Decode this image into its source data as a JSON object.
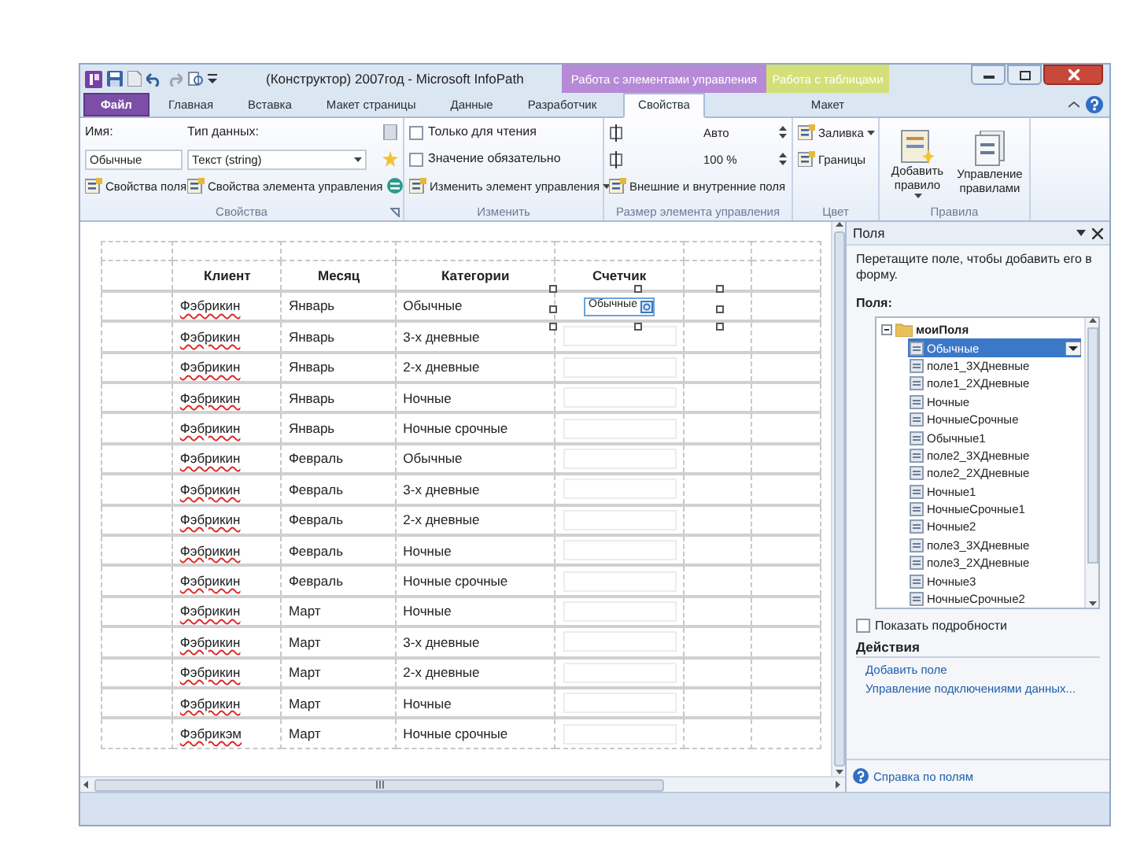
{
  "title_bar": {
    "title": "(Конструктор) 2007год - Microsoft InfoPath"
  },
  "tabs": [
    {
      "label": "Файл",
      "kind": "file",
      "selected": false
    },
    {
      "label": "Главная",
      "kind": "plain",
      "selected": false
    },
    {
      "label": "Вставка",
      "kind": "plain",
      "selected": false
    },
    {
      "label": "Макет страницы",
      "kind": "plain",
      "selected": false
    },
    {
      "label": "Данные",
      "kind": "plain",
      "selected": false
    },
    {
      "label": "Разработчик",
      "kind": "plain",
      "selected": false
    }
  ],
  "tool_groups": [
    {
      "label": "Работа с элементами управления",
      "color": "#b68ad6",
      "tabs": [
        {
          "label": "Свойства",
          "selected": true
        }
      ]
    },
    {
      "label": "Работа с таблицами",
      "color": "#d3df78",
      "tabs": [
        {
          "label": "Макет",
          "selected": false
        }
      ]
    }
  ],
  "ribbon": [
    {
      "label": "Свойства",
      "launcher": true,
      "rows": [
        [
          {
            "kind": "label",
            "text": "Имя:"
          },
          {
            "kind": "label",
            "text": "Тип данных:"
          },
          {
            "kind": "icon_button"
          }
        ],
        [
          {
            "kind": "field",
            "text": "Обычные"
          },
          {
            "kind": "field",
            "text": "Текст (string)",
            "dropdown": true
          },
          {
            "kind": "icon_button"
          }
        ],
        [
          {
            "kind": "button",
            "text": "Свойства поля"
          },
          {
            "kind": "button",
            "text": "Свойства элемента управления"
          },
          {
            "kind": "icon_button"
          }
        ]
      ]
    },
    {
      "label": "Изменить",
      "rows": [
        [
          {
            "kind": "checkbox",
            "text": "Только для чтения",
            "checked": false
          }
        ],
        [
          {
            "kind": "checkbox",
            "text": "Значение обязательно",
            "checked": false
          }
        ],
        [
          {
            "kind": "button",
            "text": "Изменить элемент управления",
            "dropdown": true
          }
        ]
      ]
    },
    {
      "label": "Размер элемента управления",
      "rows": [
        [
          {
            "kind": "spin",
            "text": "Авто"
          }
        ],
        [
          {
            "kind": "spin",
            "text": "100 %"
          }
        ],
        [
          {
            "kind": "button",
            "text": "Внешние и внутренние поля"
          }
        ]
      ]
    },
    {
      "label": "Цвет",
      "rows": [
        [
          {
            "kind": "button",
            "text": "Заливка",
            "dropdown": true
          }
        ],
        [
          {
            "kind": "button",
            "text": "Границы"
          }
        ]
      ]
    },
    {
      "label": "Правила",
      "rows": [
        [
          {
            "kind": "large",
            "text": "Добавить правило",
            "dropdown": true
          },
          {
            "kind": "large",
            "text": "Управление правилами"
          }
        ]
      ]
    }
  ],
  "table": {
    "columns": [
      "Клиент",
      "Месяц",
      "Категории",
      "Счетчик"
    ],
    "rows": [
      {
        "cells": [
          "Фэбрикин",
          "Январь",
          "Обычные"
        ],
        "spell_error": true,
        "counter": {
          "value": "Обычные",
          "selected": true
        }
      },
      {
        "cells": [
          "Фэбрикин",
          "Январь",
          "3-х дневные"
        ],
        "spell_error": true
      },
      {
        "cells": [
          "Фэбрикин",
          "Январь",
          "2-х дневные"
        ],
        "spell_error": true
      },
      {
        "cells": [
          "Фэбрикин",
          "Январь",
          "Ночные"
        ],
        "spell_error": true
      },
      {
        "cells": [
          "Фэбрикин",
          "Январь",
          "Ночные срочные"
        ],
        "spell_error": true
      },
      {
        "cells": [
          "Фэбрикин",
          "Февраль",
          "Обычные"
        ],
        "spell_error": true
      },
      {
        "cells": [
          "Фэбрикин",
          "Февраль",
          "3-х дневные"
        ],
        "spell_error": true
      },
      {
        "cells": [
          "Фэбрикин",
          "Февраль",
          "2-х дневные"
        ],
        "spell_error": true
      },
      {
        "cells": [
          "Фэбрикин",
          "Февраль",
          "Ночные"
        ],
        "spell_error": true
      },
      {
        "cells": [
          "Фэбрикин",
          "Февраль",
          "Ночные срочные"
        ],
        "spell_error": true
      },
      {
        "cells": [
          "Фэбрикин",
          "Март",
          "Ночные"
        ],
        "spell_error": true
      },
      {
        "cells": [
          "Фэбрикин",
          "Март",
          "3-х дневные"
        ],
        "spell_error": true
      },
      {
        "cells": [
          "Фэбрикин",
          "Март",
          "2-х дневные"
        ],
        "spell_error": true
      },
      {
        "cells": [
          "Фэбрикин",
          "Март",
          "Ночные"
        ],
        "spell_error": true
      },
      {
        "cells": [
          "Фэбрикэм",
          "Март",
          "Ночные срочные"
        ],
        "spell_error": true
      }
    ]
  },
  "fields_pane": {
    "title": "Поля",
    "hint": "Перетащите поле, чтобы добавить его в форму.",
    "tree_label": "Поля:",
    "tree": {
      "label": "моиПоля",
      "expanded": true,
      "children": [
        {
          "label": "Обычные",
          "selected": true
        },
        {
          "label": "поле1_3XДневные",
          "selected": false
        },
        {
          "label": "поле1_2XДневные",
          "selected": false
        },
        {
          "label": "Ночные",
          "selected": false
        },
        {
          "label": "НочныеСрочные",
          "selected": false
        },
        {
          "label": "Обычные1",
          "selected": false
        },
        {
          "label": "поле2_3XДневные",
          "selected": false
        },
        {
          "label": "поле2_2XДневные",
          "selected": false
        },
        {
          "label": "Ночные1",
          "selected": false
        },
        {
          "label": "НочныеСрочные1",
          "selected": false
        },
        {
          "label": "Ночные2",
          "selected": false
        },
        {
          "label": "поле3_3XДневные",
          "selected": false
        },
        {
          "label": "поле3_2XДневные",
          "selected": false
        },
        {
          "label": "Ночные3",
          "selected": false
        },
        {
          "label": "НочныеСрочные2",
          "selected": false
        }
      ]
    },
    "show_details": {
      "label": "Показать подробности",
      "checked": false
    },
    "actions_title": "Действия",
    "actions": [
      "Добавить поле",
      "Управление подключениями данных..."
    ],
    "help": "Справка по полям"
  }
}
